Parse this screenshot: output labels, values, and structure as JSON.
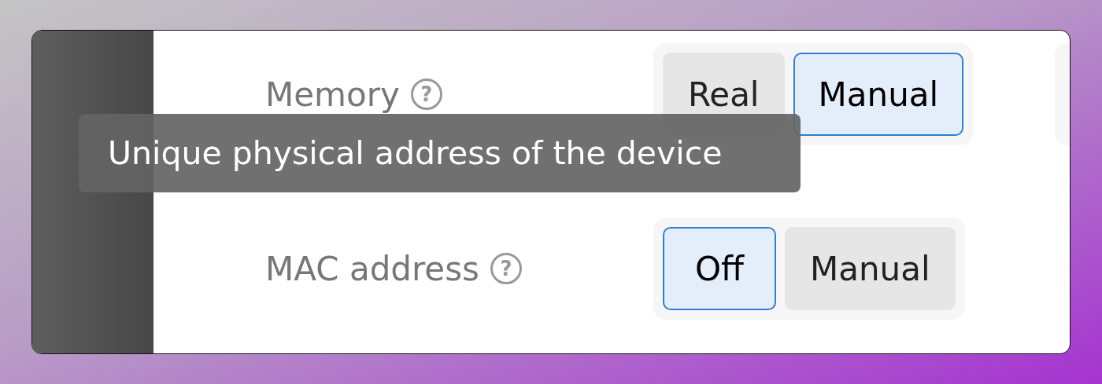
{
  "settings": [
    {
      "label": "Memory",
      "help": "?",
      "options": [
        {
          "label": "Real",
          "selected": false
        },
        {
          "label": "Manual",
          "selected": true
        }
      ]
    },
    {
      "label": "MAC address",
      "help": "?",
      "options": [
        {
          "label": "Off",
          "selected": true
        },
        {
          "label": "Manual",
          "selected": false
        }
      ]
    }
  ],
  "tooltip": {
    "text": "Unique physical address of the device"
  }
}
